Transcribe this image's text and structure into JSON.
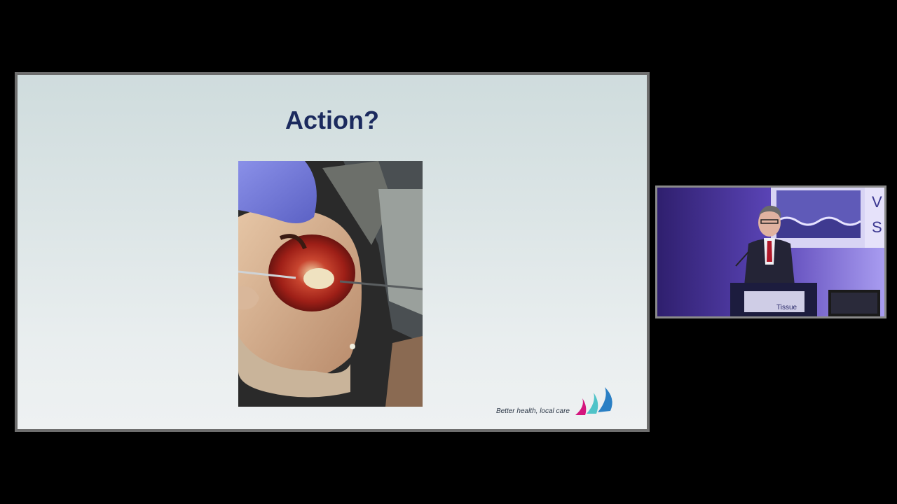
{
  "slide": {
    "title": "Action?",
    "photo_icon": "clinical-wound-photo",
    "footer_tagline": "Better health, local care",
    "logo_icon": "sail-logo-icon",
    "logo_colors": [
      "#d4167e",
      "#4fc3c8",
      "#2a7fc4"
    ]
  },
  "video": {
    "icon": "speaker-video-feed",
    "backdrop_sign_letters": [
      "V",
      "S"
    ],
    "podium_sign_text": "Tissue"
  },
  "colors": {
    "title": "#1b2a5e",
    "background": "#000000"
  }
}
